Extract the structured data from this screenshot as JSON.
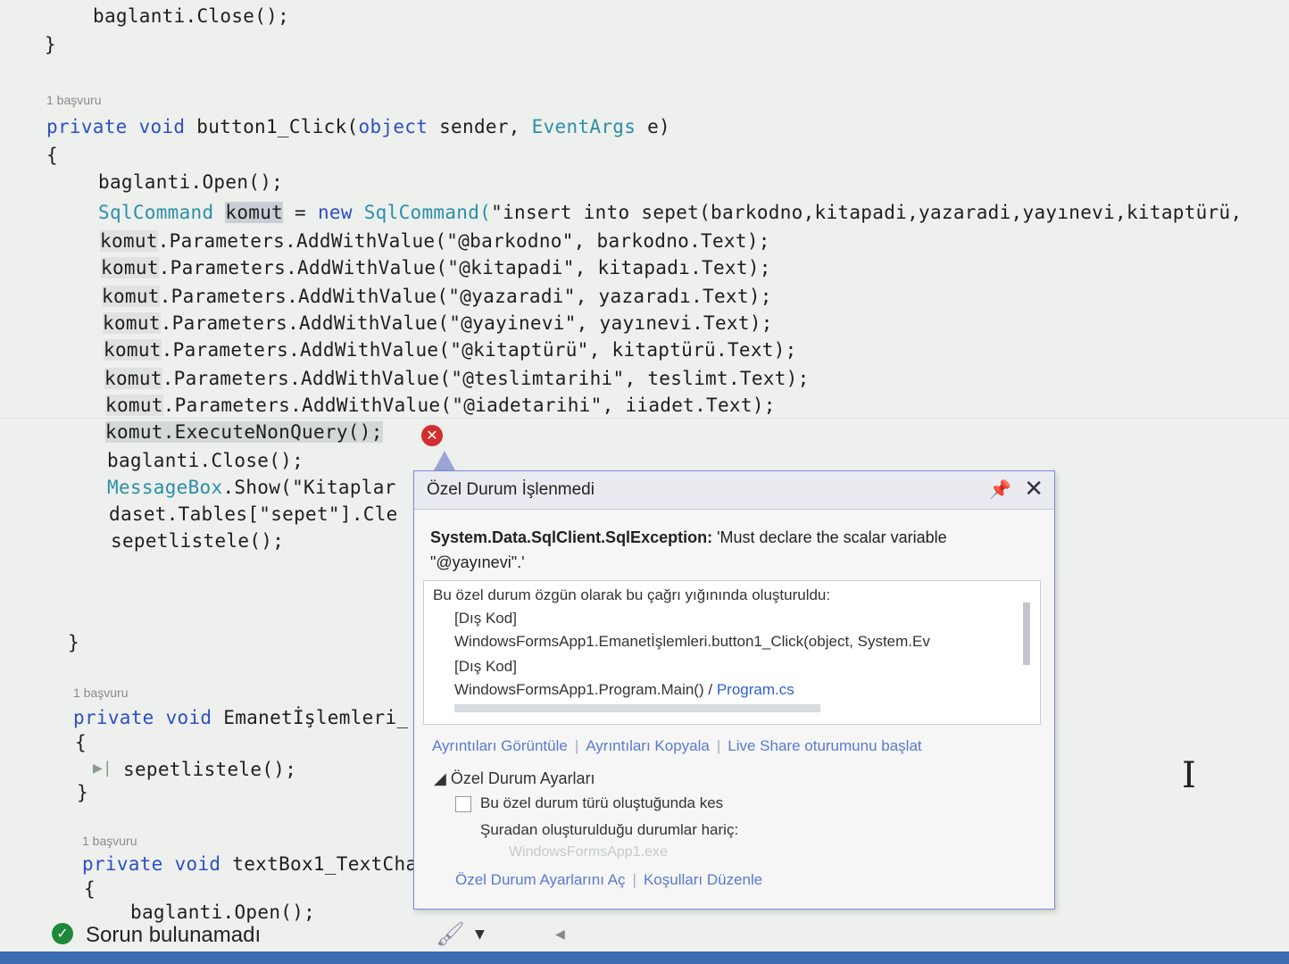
{
  "code": {
    "prev_close": "baglanti.Close();",
    "brace_close_prev": "}",
    "ref1": "1 başvuru",
    "sig1": {
      "kw1": "private",
      "kw2": "void",
      "name": "button1_Click(",
      "t1": "object",
      "p1": " sender, ",
      "t2": "EventArgs",
      "p2": " e)"
    },
    "open_brace": "{",
    "open_line": "baglanti.Open();",
    "sqlcmd": {
      "type": "SqlCommand",
      "var": "komut",
      "eq": " = ",
      "new": "new",
      "type2": " SqlCommand(",
      "str": "\"insert into sepet(barkodno,kitapadi,yazaradi,yayınevi,kitaptürü,"
    },
    "params": [
      {
        "var": "komut",
        "mid": ".Parameters.AddWithValue(",
        "str": "\"@barkodno\"",
        "tail": ", barkodno.Text);"
      },
      {
        "var": "komut",
        "mid": ".Parameters.AddWithValue(",
        "str": "\"@kitapadi\"",
        "tail": ", kitapadı.Text);"
      },
      {
        "var": "komut",
        "mid": ".Parameters.AddWithValue(",
        "str": "\"@yazaradi\"",
        "tail": ", yazaradı.Text);"
      },
      {
        "var": "komut",
        "mid": ".Parameters.AddWithValue(",
        "str": "\"@yayinevi\"",
        "tail": ", yayınevi.Text);"
      },
      {
        "var": "komut",
        "mid": ".Parameters.AddWithValue(",
        "str": "\"@kitaptürü\"",
        "tail": ", kitaptürü.Text);"
      },
      {
        "var": "komut",
        "mid": ".Parameters.AddWithValue(",
        "str": "\"@teslimtarihi\"",
        "tail": ", teslimt.Text);"
      },
      {
        "var": "komut",
        "mid": ".Parameters.AddWithValue(",
        "str": "\"@iadetarihi\"",
        "tail": ", iiadet.Text);"
      }
    ],
    "exec": {
      "var": "komut",
      "rest": ".ExecuteNonQuery();"
    },
    "close_line": "baglanti.Close();",
    "msgbox": {
      "type": "MessageBox",
      "rest": ".Show(",
      "str": "\"Kitaplar"
    },
    "daset": {
      "pre": "daset.Tables[",
      "str": "\"sepet\"",
      "rest": "].Cle"
    },
    "sepetlistele": "sepetlistele();",
    "brace_close": "}",
    "ref2": "1 başvuru",
    "sig2": {
      "kw1": "private",
      "kw2": "void",
      "name": "Emanetİşlemleri_"
    },
    "brace2_open": "{",
    "sepetlistele2": "sepetlistele();",
    "brace2_close": "}",
    "ref3": "1 başvuru",
    "sig3": {
      "kw1": "private",
      "kw2": "void",
      "name": "textBox1_TextCha"
    },
    "brace3_open": "{",
    "open_line3": "baglanti.Open();"
  },
  "popup": {
    "title": "Özel Durum İşlenmedi",
    "exception_type": "System.Data.SqlClient.SqlException:",
    "exception_msg": "'Must declare the scalar variable \"@yayınevi\".'",
    "stack_header": "Bu özel durum özgün olarak bu çağrı yığınında oluşturuldu:",
    "stack": [
      "[Dış Kod]",
      "WindowsFormsApp1.Emanetİşlemleri.button1_Click(object, System.Ev",
      "[Dış Kod]",
      "WindowsFormsApp1.Program.Main()"
    ],
    "stack_link_sep": " / ",
    "stack_link": "Program.cs",
    "actions": [
      "Ayrıntıları Görüntüle",
      "Ayrıntıları Kopyala",
      "Live Share oturumunu başlat"
    ],
    "settings_title": "Özel Durum Ayarları",
    "checkbox_label": "Bu özel durum türü oluştuğunda kes",
    "except_label": "Şuradan oluşturulduğu durumlar hariç:",
    "exe_label": "WindowsFormsApp1.exe",
    "bottom_actions": [
      "Özel Durum Ayarlarını Aç",
      "Koşulları Düzenle"
    ]
  },
  "status": {
    "text": "Sorun bulunamadı"
  },
  "colors": {
    "keyword": "#2c4fc4",
    "type": "#2b8fa8",
    "string": "#a3231b",
    "error": "#d32f2f",
    "ok": "#1d8a3a"
  }
}
